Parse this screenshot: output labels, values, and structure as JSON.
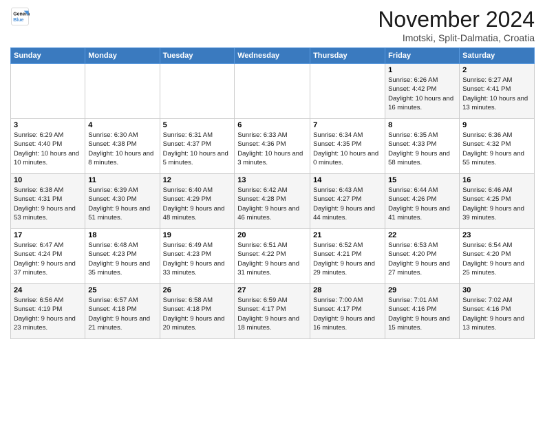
{
  "logo": {
    "line1": "General",
    "line2": "Blue"
  },
  "title": "November 2024",
  "subtitle": "Imotski, Split-Dalmatia, Croatia",
  "weekdays": [
    "Sunday",
    "Monday",
    "Tuesday",
    "Wednesday",
    "Thursday",
    "Friday",
    "Saturday"
  ],
  "weeks": [
    [
      {
        "day": "",
        "info": ""
      },
      {
        "day": "",
        "info": ""
      },
      {
        "day": "",
        "info": ""
      },
      {
        "day": "",
        "info": ""
      },
      {
        "day": "",
        "info": ""
      },
      {
        "day": "1",
        "info": "Sunrise: 6:26 AM\nSunset: 4:42 PM\nDaylight: 10 hours and 16 minutes."
      },
      {
        "day": "2",
        "info": "Sunrise: 6:27 AM\nSunset: 4:41 PM\nDaylight: 10 hours and 13 minutes."
      }
    ],
    [
      {
        "day": "3",
        "info": "Sunrise: 6:29 AM\nSunset: 4:40 PM\nDaylight: 10 hours and 10 minutes."
      },
      {
        "day": "4",
        "info": "Sunrise: 6:30 AM\nSunset: 4:38 PM\nDaylight: 10 hours and 8 minutes."
      },
      {
        "day": "5",
        "info": "Sunrise: 6:31 AM\nSunset: 4:37 PM\nDaylight: 10 hours and 5 minutes."
      },
      {
        "day": "6",
        "info": "Sunrise: 6:33 AM\nSunset: 4:36 PM\nDaylight: 10 hours and 3 minutes."
      },
      {
        "day": "7",
        "info": "Sunrise: 6:34 AM\nSunset: 4:35 PM\nDaylight: 10 hours and 0 minutes."
      },
      {
        "day": "8",
        "info": "Sunrise: 6:35 AM\nSunset: 4:33 PM\nDaylight: 9 hours and 58 minutes."
      },
      {
        "day": "9",
        "info": "Sunrise: 6:36 AM\nSunset: 4:32 PM\nDaylight: 9 hours and 55 minutes."
      }
    ],
    [
      {
        "day": "10",
        "info": "Sunrise: 6:38 AM\nSunset: 4:31 PM\nDaylight: 9 hours and 53 minutes."
      },
      {
        "day": "11",
        "info": "Sunrise: 6:39 AM\nSunset: 4:30 PM\nDaylight: 9 hours and 51 minutes."
      },
      {
        "day": "12",
        "info": "Sunrise: 6:40 AM\nSunset: 4:29 PM\nDaylight: 9 hours and 48 minutes."
      },
      {
        "day": "13",
        "info": "Sunrise: 6:42 AM\nSunset: 4:28 PM\nDaylight: 9 hours and 46 minutes."
      },
      {
        "day": "14",
        "info": "Sunrise: 6:43 AM\nSunset: 4:27 PM\nDaylight: 9 hours and 44 minutes."
      },
      {
        "day": "15",
        "info": "Sunrise: 6:44 AM\nSunset: 4:26 PM\nDaylight: 9 hours and 41 minutes."
      },
      {
        "day": "16",
        "info": "Sunrise: 6:46 AM\nSunset: 4:25 PM\nDaylight: 9 hours and 39 minutes."
      }
    ],
    [
      {
        "day": "17",
        "info": "Sunrise: 6:47 AM\nSunset: 4:24 PM\nDaylight: 9 hours and 37 minutes."
      },
      {
        "day": "18",
        "info": "Sunrise: 6:48 AM\nSunset: 4:23 PM\nDaylight: 9 hours and 35 minutes."
      },
      {
        "day": "19",
        "info": "Sunrise: 6:49 AM\nSunset: 4:23 PM\nDaylight: 9 hours and 33 minutes."
      },
      {
        "day": "20",
        "info": "Sunrise: 6:51 AM\nSunset: 4:22 PM\nDaylight: 9 hours and 31 minutes."
      },
      {
        "day": "21",
        "info": "Sunrise: 6:52 AM\nSunset: 4:21 PM\nDaylight: 9 hours and 29 minutes."
      },
      {
        "day": "22",
        "info": "Sunrise: 6:53 AM\nSunset: 4:20 PM\nDaylight: 9 hours and 27 minutes."
      },
      {
        "day": "23",
        "info": "Sunrise: 6:54 AM\nSunset: 4:20 PM\nDaylight: 9 hours and 25 minutes."
      }
    ],
    [
      {
        "day": "24",
        "info": "Sunrise: 6:56 AM\nSunset: 4:19 PM\nDaylight: 9 hours and 23 minutes."
      },
      {
        "day": "25",
        "info": "Sunrise: 6:57 AM\nSunset: 4:18 PM\nDaylight: 9 hours and 21 minutes."
      },
      {
        "day": "26",
        "info": "Sunrise: 6:58 AM\nSunset: 4:18 PM\nDaylight: 9 hours and 20 minutes."
      },
      {
        "day": "27",
        "info": "Sunrise: 6:59 AM\nSunset: 4:17 PM\nDaylight: 9 hours and 18 minutes."
      },
      {
        "day": "28",
        "info": "Sunrise: 7:00 AM\nSunset: 4:17 PM\nDaylight: 9 hours and 16 minutes."
      },
      {
        "day": "29",
        "info": "Sunrise: 7:01 AM\nSunset: 4:16 PM\nDaylight: 9 hours and 15 minutes."
      },
      {
        "day": "30",
        "info": "Sunrise: 7:02 AM\nSunset: 4:16 PM\nDaylight: 9 hours and 13 minutes."
      }
    ]
  ]
}
